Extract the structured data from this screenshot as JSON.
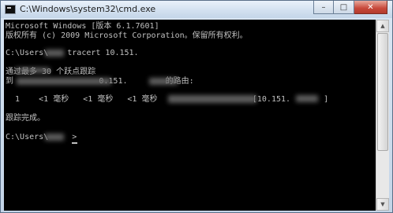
{
  "window": {
    "title": "C:\\Windows\\system32\\cmd.exe",
    "buttons": {
      "minimize": "–",
      "maximize": "□",
      "close": "✕"
    },
    "icon": "console-icon"
  },
  "console": {
    "lines": [
      "Microsoft Windows [版本 6.1.7601]",
      "版权所有 (c) 2009 Microsoft Corporation。保留所有权利。",
      "",
      "C:\\Users\\    tracert 10.151.",
      "",
      "通过最多 30 个跃点跟踪",
      "到                  0.151.        的路由:",
      "",
      "  1    <1 毫秒   <1 毫秒   <1 毫秒                    [10.151.       ]",
      "",
      "跟踪完成。",
      "",
      "C:\\Users\\     >"
    ]
  },
  "scrollbar": {
    "up": "▲",
    "down": "▼"
  }
}
